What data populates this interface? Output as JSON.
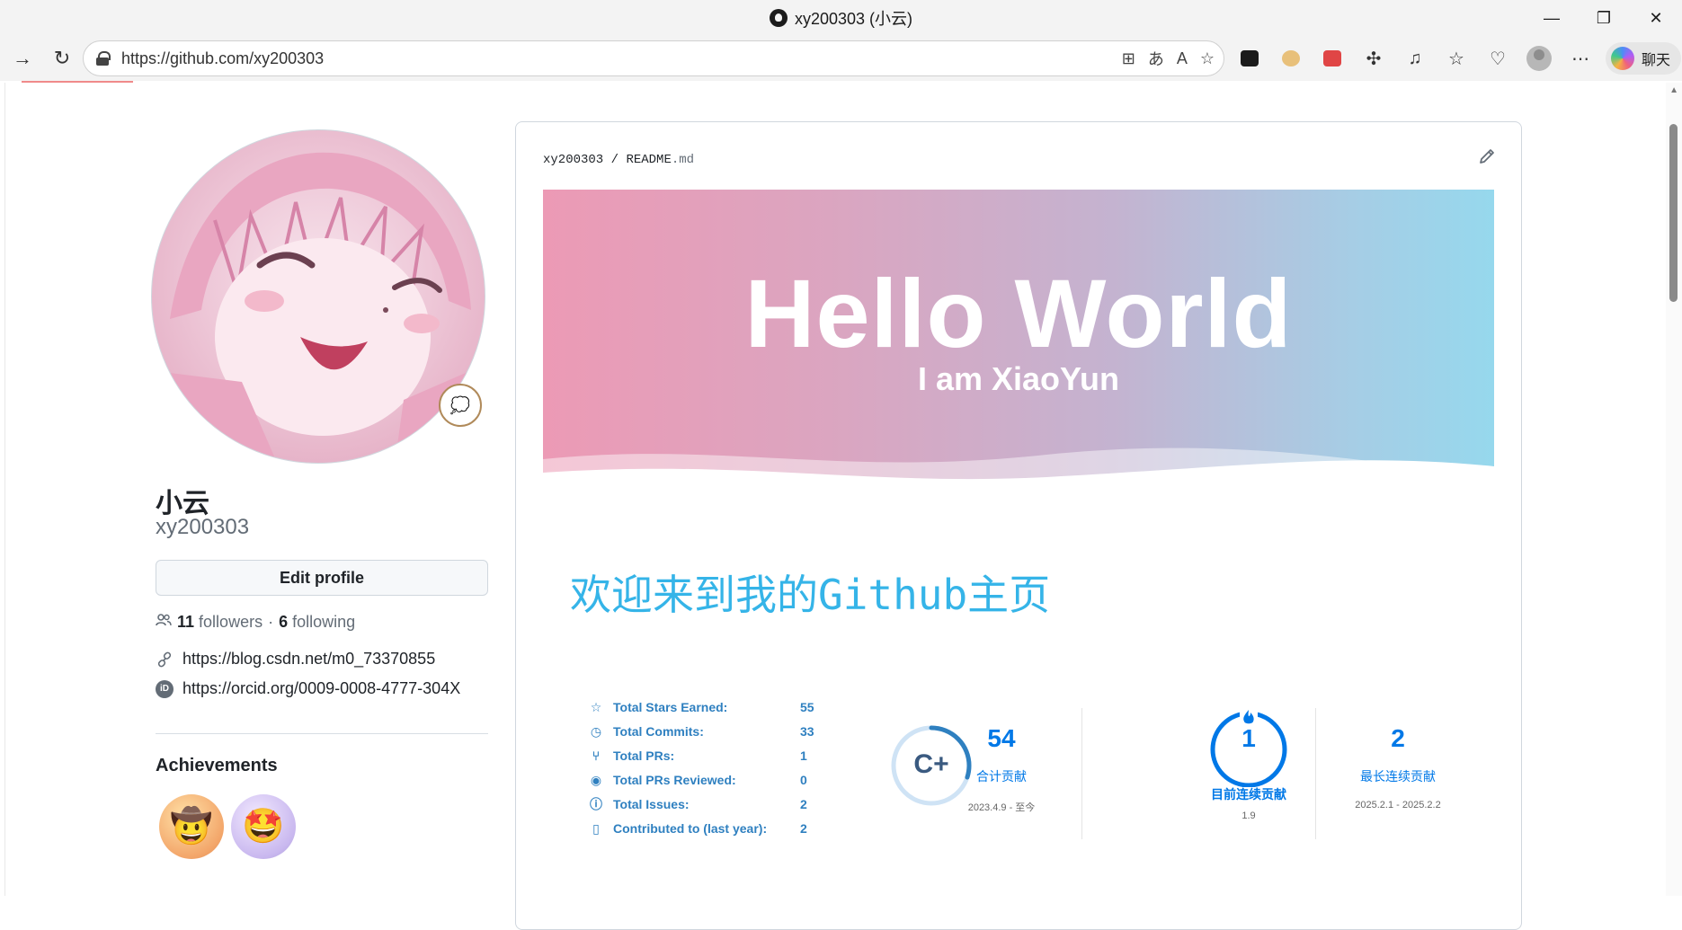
{
  "window": {
    "title": "xy200303 (小云)",
    "minimize": "—",
    "restore": "❐",
    "close": "✕"
  },
  "browser": {
    "back": "→",
    "reload": "↻",
    "url": "https://github.com/xy200303",
    "addr_icons": [
      "⊞",
      "あ",
      "A",
      "☆"
    ],
    "copilot_label": "聊天",
    "more": "⋯"
  },
  "profile": {
    "display_name": "小云",
    "login": "xy200303",
    "status_emoji": "💭",
    "edit_profile": "Edit profile",
    "followers_count": "11",
    "followers_label": "followers",
    "separator": "·",
    "following_count": "6",
    "following_label": "following",
    "links": [
      {
        "icon": "link-icon",
        "text": "https://blog.csdn.net/m0_73370855"
      },
      {
        "icon": "orcid-icon",
        "text": "https://orcid.org/0009-0008-4777-304X"
      }
    ],
    "orcid_glyph": "iD",
    "achievements_title": "Achievements",
    "achievement_badges": [
      "🤠",
      "🤩"
    ]
  },
  "readme": {
    "owner": "xy200303",
    "path_sep": "/",
    "file_base": "README",
    "file_ext": ".md",
    "banner_title": "Hello World",
    "banner_subtitle": "I am XiaoYun",
    "welcome": "欢迎来到我的Github主页"
  },
  "stats": {
    "rows": [
      {
        "icon": "star-icon",
        "label": "Total Stars Earned:",
        "value": "55"
      },
      {
        "icon": "history-icon",
        "label": "Total Commits:",
        "value": "33"
      },
      {
        "icon": "pull-request-icon",
        "label": "Total PRs:",
        "value": "1"
      },
      {
        "icon": "eye-icon",
        "label": "Total PRs Reviewed:",
        "value": "0"
      },
      {
        "icon": "issue-icon",
        "label": "Total Issues:",
        "value": "2"
      },
      {
        "icon": "repo-icon",
        "label": "Contributed to (last year):",
        "value": "2"
      }
    ],
    "rank": "C+",
    "rank_progress": 0.3
  },
  "streak": {
    "total": {
      "value": "54",
      "label": "合计贡献",
      "range": "2023.4.9 - 至今"
    },
    "current": {
      "value": "1",
      "label": "目前连续贡献",
      "range": "1.9"
    },
    "longest": {
      "value": "2",
      "label": "最长连续贡献",
      "range": "2025.2.1 - 2025.2.2"
    }
  },
  "colors": {
    "stat_blue": "#2f80c0",
    "streak_blue": "#0078e7",
    "welcome_blue": "#35b4e8"
  }
}
